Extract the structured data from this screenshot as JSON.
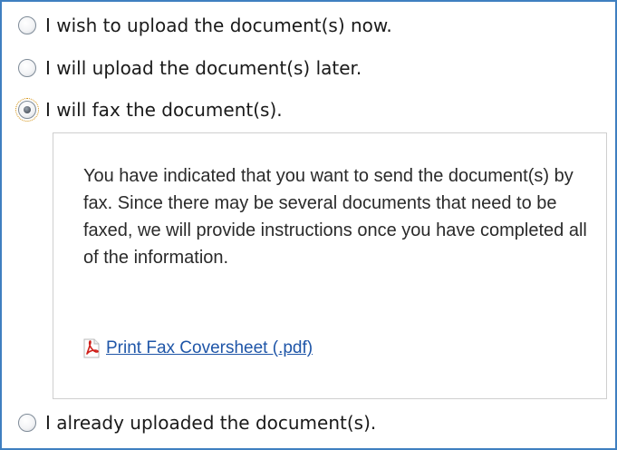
{
  "options": [
    {
      "label": "I wish to upload the document(s) now.",
      "checked": false
    },
    {
      "label": "I will upload the document(s) later.",
      "checked": false
    },
    {
      "label": "I will fax the document(s).",
      "checked": true
    },
    {
      "label": "I already uploaded the document(s).",
      "checked": false
    }
  ],
  "fax_info": {
    "message": "You have indicated that you want to send the document(s) by fax. Since there may be several documents that need to be faxed, we will provide instructions once you have completed all of the information.",
    "link_label": "Print Fax Coversheet (.pdf)",
    "link_icon": "pdf-icon"
  },
  "colors": {
    "frame_border": "#3f7fc0",
    "link": "#1f56a8",
    "focus_ring": "#d08a00"
  }
}
